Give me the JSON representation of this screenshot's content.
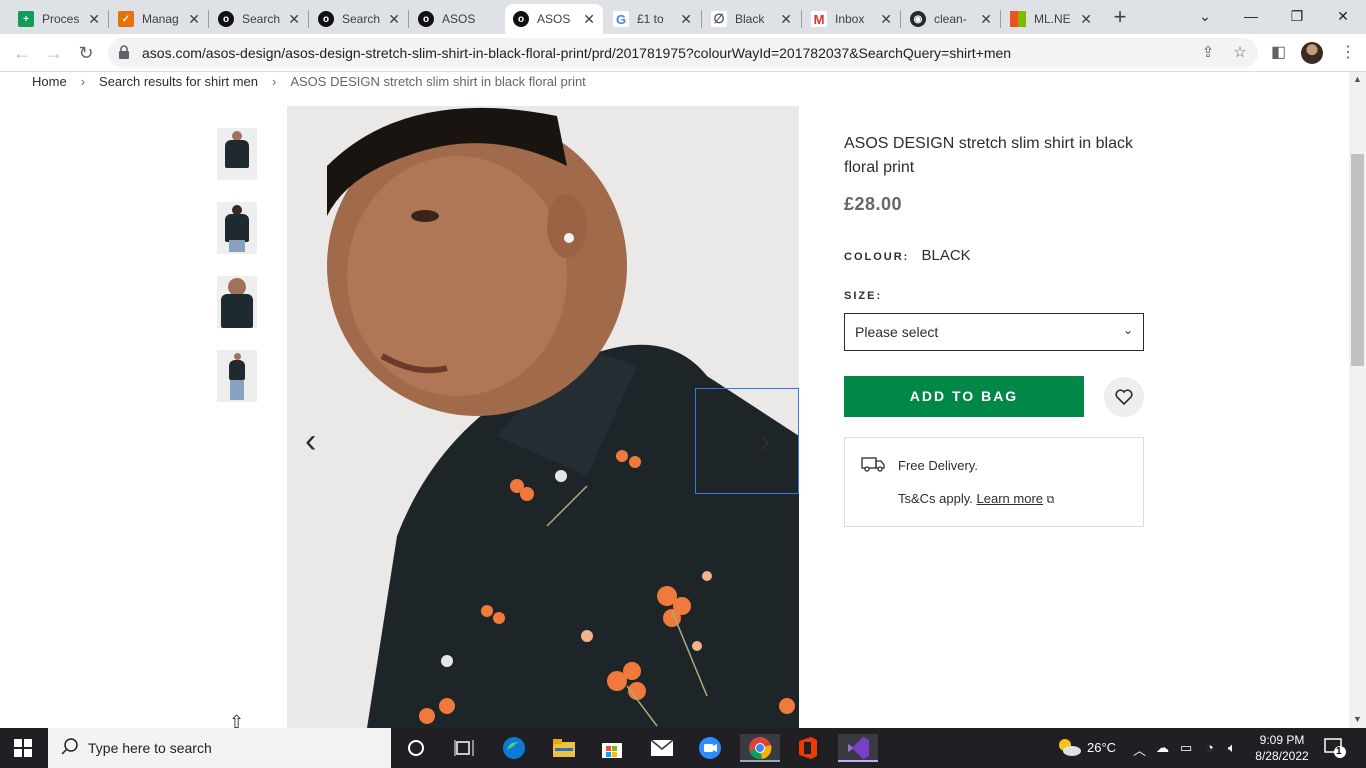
{
  "browser": {
    "tabs": [
      {
        "title": "Proces",
        "favicon": "sheets-icon",
        "color": "#0f9d58"
      },
      {
        "title": "Manag",
        "favicon": "check-icon",
        "color": "#e8710a"
      },
      {
        "title": "Search",
        "favicon": "asos-icon",
        "color": "#111"
      },
      {
        "title": "Search",
        "favicon": "asos-icon",
        "color": "#111"
      },
      {
        "title": "ASOS",
        "favicon": "asos-icon",
        "color": "#111"
      },
      {
        "title": "ASOS",
        "favicon": "asos-icon",
        "color": "#111",
        "active": true
      },
      {
        "title": "£1 to",
        "favicon": "google-icon",
        "color": "#4285f4"
      },
      {
        "title": "Black",
        "favicon": "link-icon",
        "color": "#555"
      },
      {
        "title": "Inbox",
        "favicon": "gmail-icon",
        "color": "#d93025"
      },
      {
        "title": "clean-",
        "favicon": "github-icon",
        "color": "#24292e"
      },
      {
        "title": "ML.NE",
        "favicon": "microsoft-icon",
        "color": "#f25022"
      }
    ],
    "url": "asos.com/asos-design/asos-design-stretch-slim-shirt-in-black-floral-print/prd/201781975?colourWayId=201782037&SearchQuery=shirt+men"
  },
  "breadcrumb": {
    "home": "Home",
    "search": "Search results for shirt men",
    "current": "ASOS DESIGN stretch slim shirt in black floral print"
  },
  "product": {
    "title": "ASOS DESIGN stretch slim shirt in black floral print",
    "price": "£28.00",
    "colour_label": "COLOUR:",
    "colour_value": "BLACK",
    "size_label": "SIZE:",
    "size_placeholder": "Please select",
    "add_to_bag": "ADD TO BAG",
    "delivery_title": "Free Delivery.",
    "delivery_terms": "Ts&Cs apply.",
    "learn_more": "Learn more"
  },
  "taskbar": {
    "search_placeholder": "Type here to search",
    "weather": "26°C",
    "time": "9:09 PM",
    "date": "8/28/2022",
    "notifications": "1"
  }
}
